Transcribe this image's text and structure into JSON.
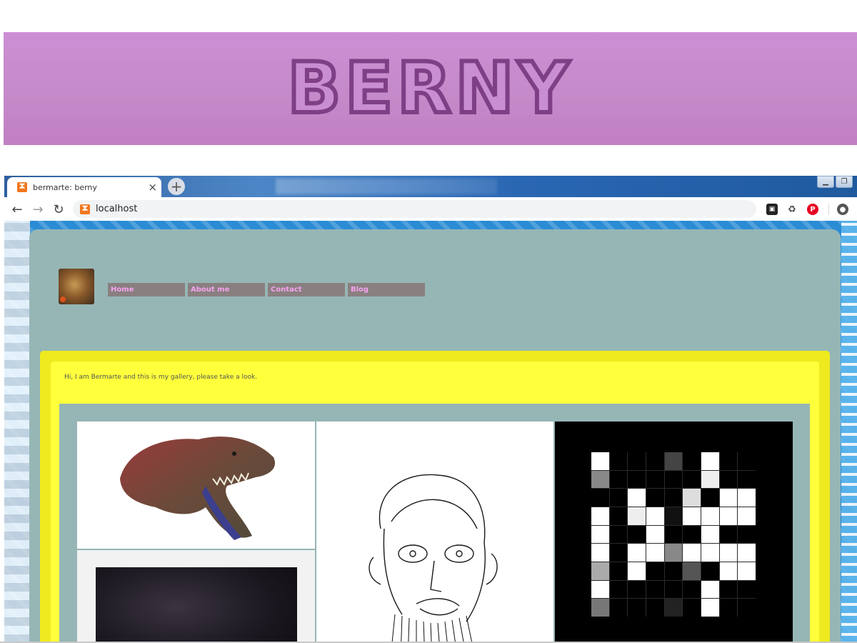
{
  "banner": {
    "title": "Berny"
  },
  "browser": {
    "tab": {
      "title": "bermarte: berny",
      "close": "×",
      "favicon": "xampp-icon"
    },
    "new_tab": "+",
    "window_controls": {
      "minimize": "▁",
      "restore": "❐"
    },
    "toolbar": {
      "back": "←",
      "forward": "→",
      "reload": "↻",
      "url": "localhost"
    },
    "extensions": [
      "trello-icon",
      "recycle-icon",
      "pinterest-icon"
    ],
    "profile": "profile-icon"
  },
  "site": {
    "nav": [
      "Home",
      "About me",
      "Contact",
      "Blog"
    ],
    "intro": "Hi, I am Bermarte and this is my gallery, please take a look.",
    "gallery": {
      "items": [
        "dinosaur-head",
        "face-sketch",
        "pixel-pattern",
        "dark-painting"
      ]
    },
    "colors": {
      "banner": "#c98ed1",
      "site_bg": "#96b6b5",
      "content_outer": "#eeea1f",
      "content_inner": "#ffff3c",
      "nav_bg": "#8a7f80",
      "nav_text": "#f7a3f0"
    }
  }
}
